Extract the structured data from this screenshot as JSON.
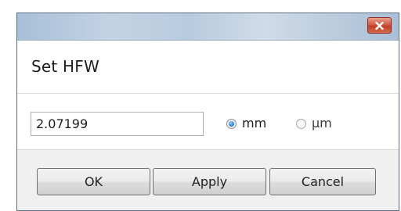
{
  "dialog": {
    "title": "Set HFW",
    "close_icon": "close-icon"
  },
  "form": {
    "value": "2.07199",
    "units": [
      {
        "label": "mm",
        "checked": true
      },
      {
        "label": "µm",
        "checked": false
      }
    ]
  },
  "buttons": {
    "ok": "OK",
    "apply": "Apply",
    "cancel": "Cancel"
  },
  "colors": {
    "close_button": "#c23f24",
    "radio_selected": "#2f86d6"
  }
}
